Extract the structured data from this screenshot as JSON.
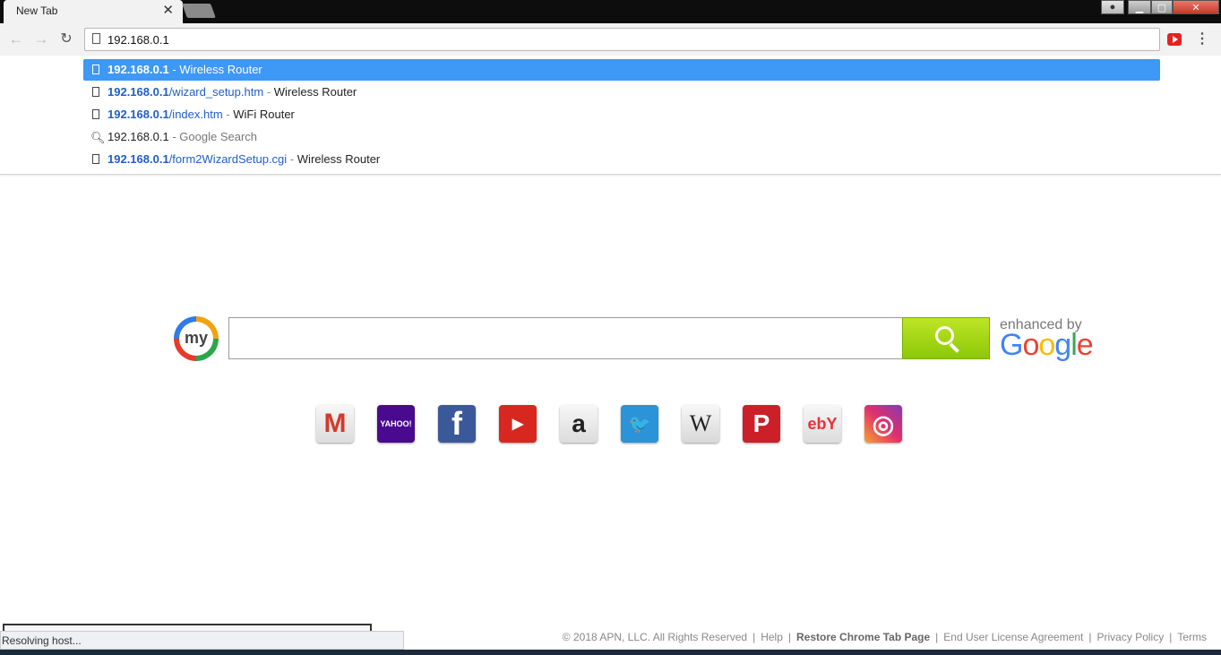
{
  "browser": {
    "tab_title": "New Tab",
    "tab_close": "✕",
    "address": "192.168.0.1",
    "extension_icon": "youtube-icon",
    "menu_icon": "⋮"
  },
  "suggestions": [
    {
      "icon": "page-icon",
      "url_bold": "192.168.0.1",
      "url_rest": "",
      "sep": "-",
      "title": "Wireless Router",
      "selected": true
    },
    {
      "icon": "page-icon",
      "url_bold": "192.168.0.1",
      "url_rest": "/wizard_setup.htm",
      "sep": "-",
      "title": "Wireless Router"
    },
    {
      "icon": "page-icon",
      "url_bold": "192.168.0.1",
      "url_rest": "/index.htm",
      "sep": "-",
      "title": "WiFi Router"
    },
    {
      "icon": "search-icon",
      "query": "192.168.0.1",
      "sep": "-",
      "title": "Google Search"
    },
    {
      "icon": "page-icon",
      "url_bold": "192.168.0.1",
      "url_rest": "/form2WizardSetup.cgi",
      "sep": "-",
      "title": "Wireless Router"
    }
  ],
  "search": {
    "logo_text": "my",
    "enhanced_by": "enhanced by",
    "google": "Google"
  },
  "tiles": [
    {
      "name": "gmail",
      "label": "M"
    },
    {
      "name": "yahoo",
      "label": "YAHOO!"
    },
    {
      "name": "facebook",
      "label": "f"
    },
    {
      "name": "youtube",
      "label": "▶"
    },
    {
      "name": "amazon",
      "label": "a"
    },
    {
      "name": "twitter",
      "label": "🐦"
    },
    {
      "name": "wikipedia",
      "label": "W"
    },
    {
      "name": "pinterest",
      "label": "P"
    },
    {
      "name": "ebay",
      "label": "ebY"
    },
    {
      "name": "instagram",
      "label": "◎"
    }
  ],
  "status_text": "Resolving host...",
  "footer": {
    "copyright": "© 2018 APN, LLC. All Rights Reserved",
    "help": "Help",
    "restore": "Restore Chrome Tab Page",
    "eula": "End User License Agreement",
    "privacy": "Privacy Policy",
    "terms": "Terms"
  },
  "colors": {
    "accent_selected": "#3e98f5",
    "search_button": "#9bd30a"
  }
}
